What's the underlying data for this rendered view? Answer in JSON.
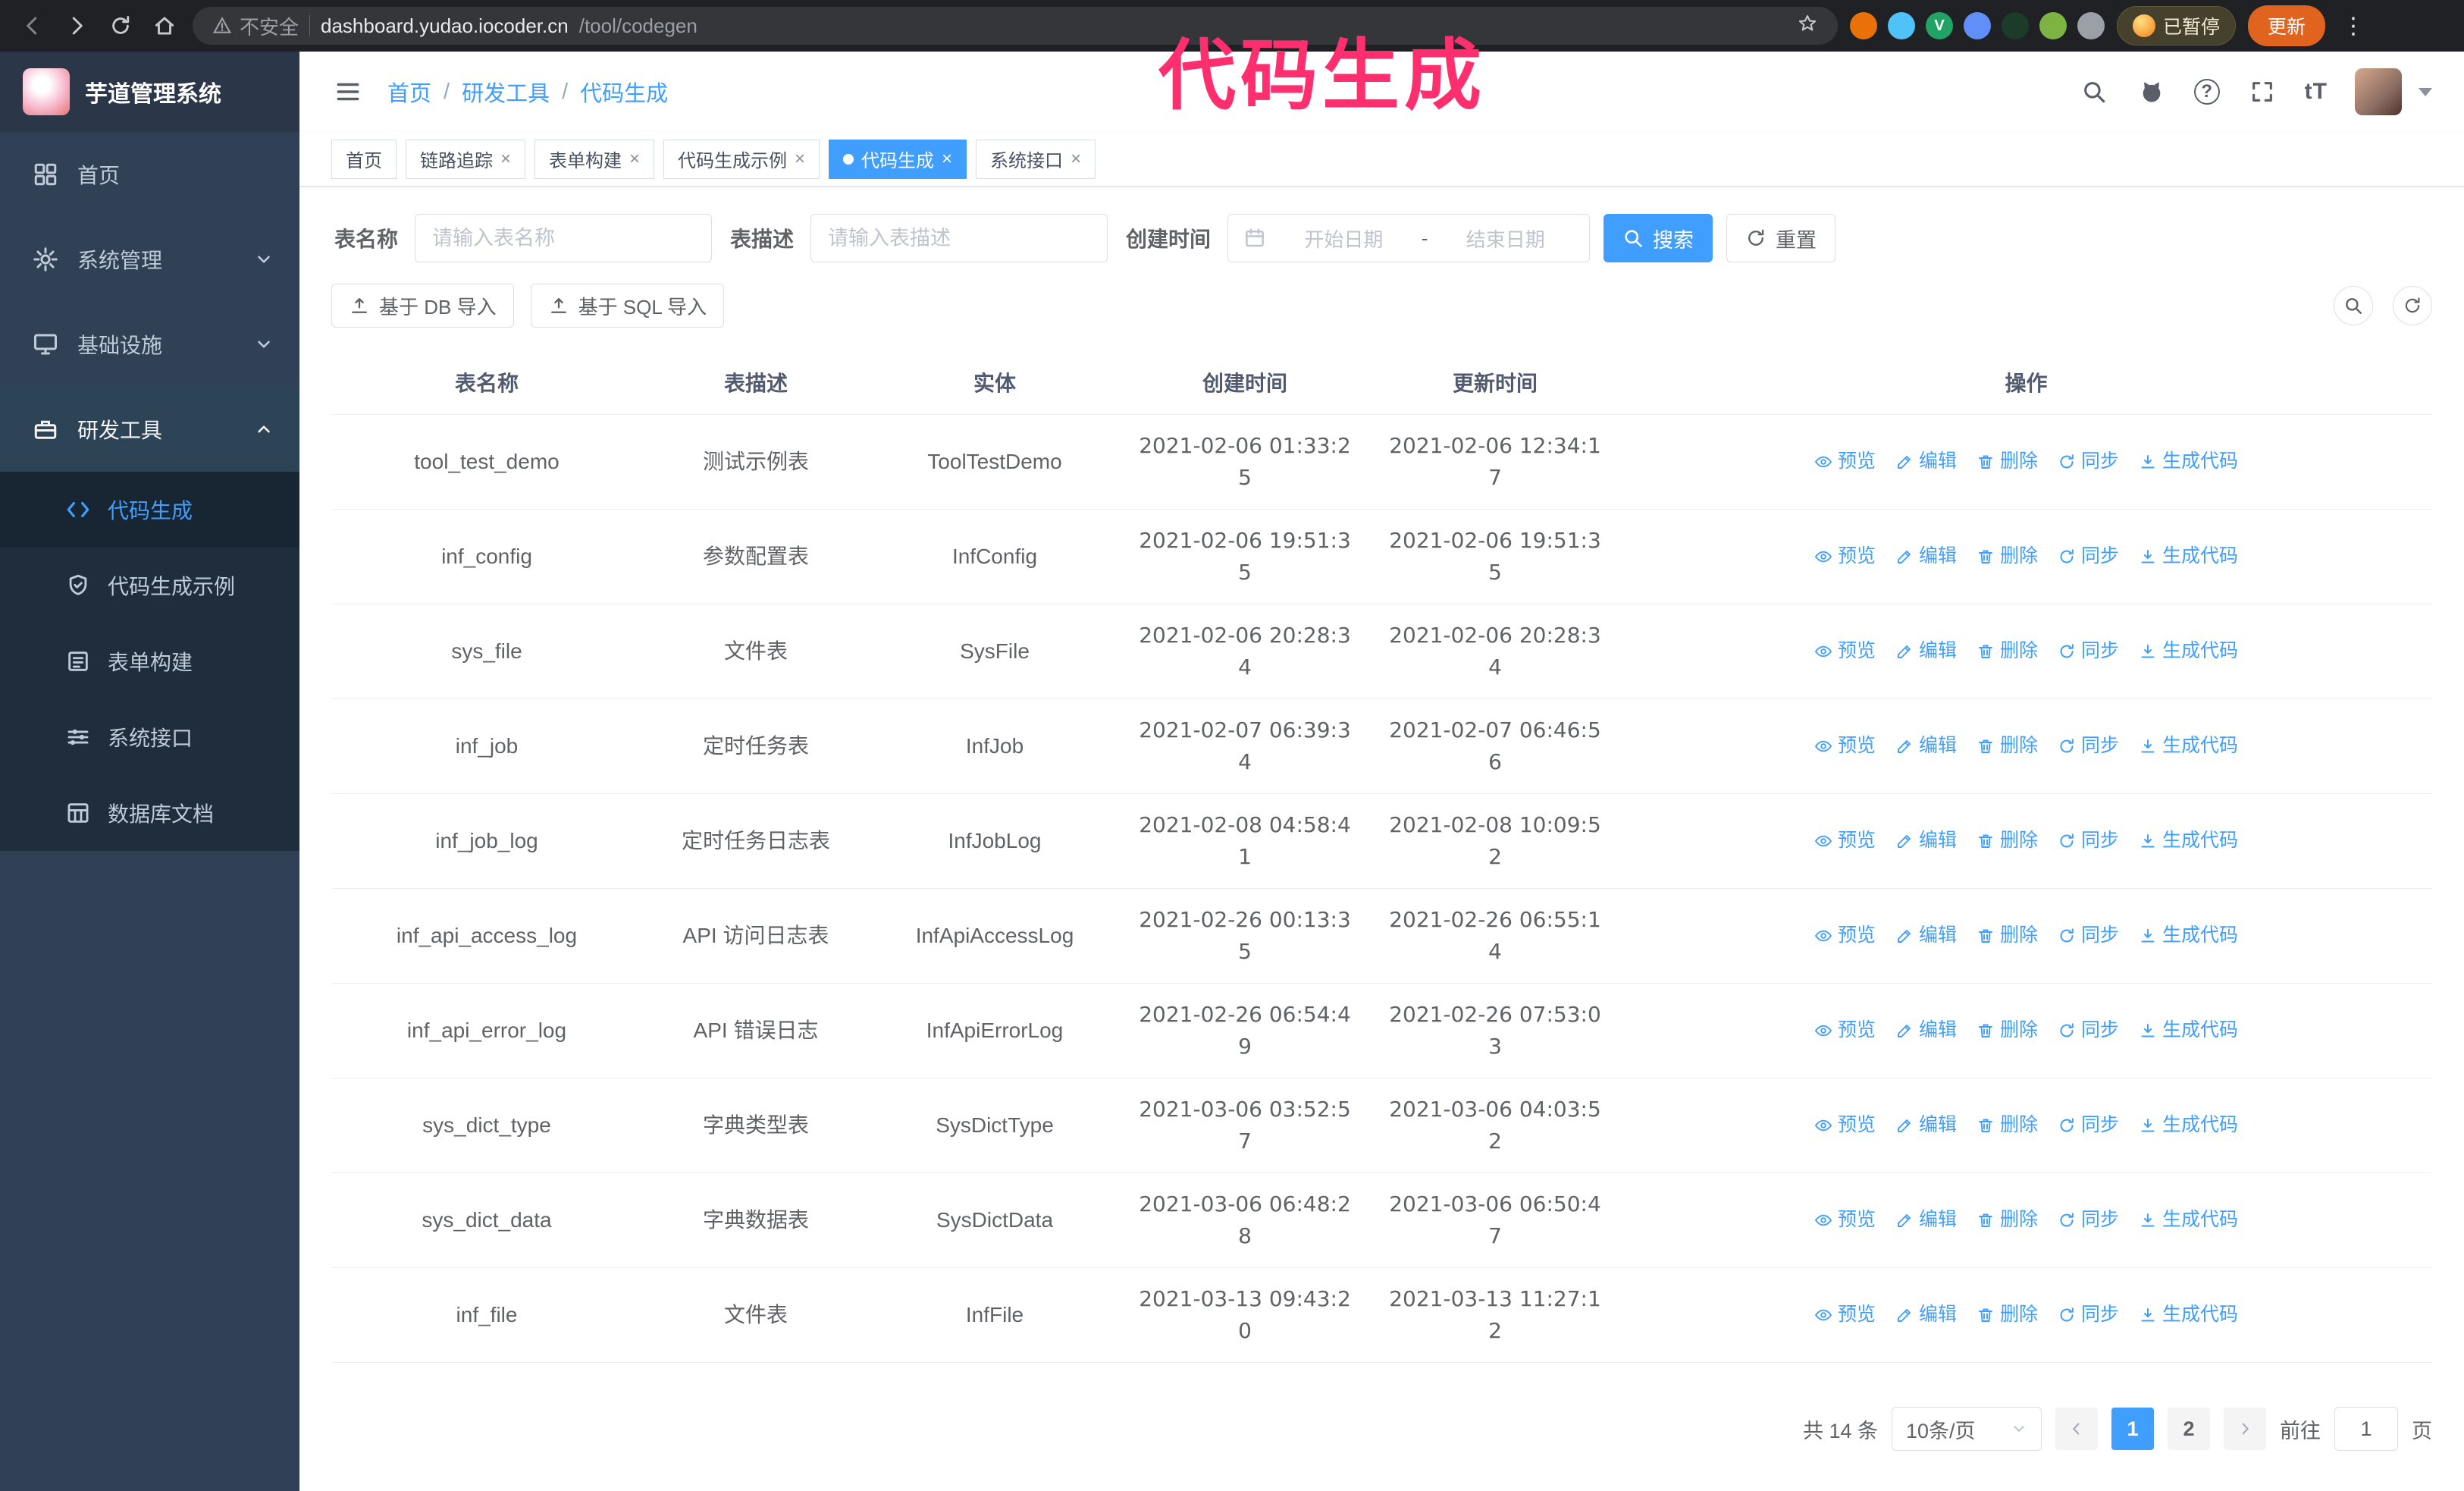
{
  "annotation": {
    "text": "代码生成"
  },
  "colors": {
    "accent": "#409eff",
    "sidebar_bg": "#304156",
    "submenu_bg": "#1f2d3d",
    "annotation_pink": "#ff2f6f",
    "update_orange": "#e0641e"
  },
  "browser": {
    "security_label": "不安全",
    "url_host": "dashboard.yudao.iocoder.cn",
    "url_path": "/tool/codegen",
    "extension_v_label": "V",
    "paused_badge": "已暂停",
    "update_button": "更新"
  },
  "sidebar": {
    "logo_title": "芋道管理系统",
    "items": [
      {
        "label": "首页"
      },
      {
        "label": "系统管理"
      },
      {
        "label": "基础设施"
      },
      {
        "label": "研发工具"
      }
    ],
    "subitems": [
      {
        "label": "代码生成"
      },
      {
        "label": "代码生成示例"
      },
      {
        "label": "表单构建"
      },
      {
        "label": "系统接口"
      },
      {
        "label": "数据库文档"
      }
    ]
  },
  "header": {
    "breadcrumb": [
      "首页",
      "研发工具",
      "代码生成"
    ],
    "separator": "/"
  },
  "tabs": [
    {
      "label": "首页"
    },
    {
      "label": "链路追踪"
    },
    {
      "label": "表单构建"
    },
    {
      "label": "代码生成示例"
    },
    {
      "label": "代码生成"
    },
    {
      "label": "系统接口"
    }
  ],
  "filters": {
    "table_name_label": "表名称",
    "table_name_placeholder": "请输入表名称",
    "table_desc_label": "表描述",
    "table_desc_placeholder": "请输入表描述",
    "create_time_label": "创建时间",
    "date_start_placeholder": "开始日期",
    "date_separator": "-",
    "date_end_placeholder": "结束日期",
    "search_button": "搜索",
    "reset_button": "重置"
  },
  "toolbar": {
    "import_db": "基于 DB 导入",
    "import_sql": "基于 SQL 导入"
  },
  "icons": {
    "search": "magnifier",
    "github": "github-cat",
    "help": "question-circle",
    "fullscreen": "expand-corners",
    "font_size": "tT",
    "refresh": "circular-arrows",
    "upload": "upload-tray",
    "calendar": "calendar",
    "preview": "eye",
    "edit": "pencil",
    "delete": "trash",
    "sync": "circular-arrows",
    "generate": "download-tray"
  },
  "table": {
    "columns": [
      "表名称",
      "表描述",
      "实体",
      "创建时间",
      "更新时间",
      "操作"
    ],
    "actions": [
      "预览",
      "编辑",
      "删除",
      "同步",
      "生成代码"
    ],
    "rows": [
      {
        "name": "tool_test_demo",
        "desc": "测试示例表",
        "entity": "ToolTestDemo",
        "created": "2021-02-06 01:33:25",
        "updated": "2021-02-06 12:34:17"
      },
      {
        "name": "inf_config",
        "desc": "参数配置表",
        "entity": "InfConfig",
        "created": "2021-02-06 19:51:35",
        "updated": "2021-02-06 19:51:35"
      },
      {
        "name": "sys_file",
        "desc": "文件表",
        "entity": "SysFile",
        "created": "2021-02-06 20:28:34",
        "updated": "2021-02-06 20:28:34"
      },
      {
        "name": "inf_job",
        "desc": "定时任务表",
        "entity": "InfJob",
        "created": "2021-02-07 06:39:34",
        "updated": "2021-02-07 06:46:56"
      },
      {
        "name": "inf_job_log",
        "desc": "定时任务日志表",
        "entity": "InfJobLog",
        "created": "2021-02-08 04:58:41",
        "updated": "2021-02-08 10:09:52"
      },
      {
        "name": "inf_api_access_log",
        "desc": "API 访问日志表",
        "entity": "InfApiAccessLog",
        "created": "2021-02-26 00:13:35",
        "updated": "2021-02-26 06:55:14"
      },
      {
        "name": "inf_api_error_log",
        "desc": "API 错误日志",
        "entity": "InfApiErrorLog",
        "created": "2021-02-26 06:54:49",
        "updated": "2021-02-26 07:53:03"
      },
      {
        "name": "sys_dict_type",
        "desc": "字典类型表",
        "entity": "SysDictType",
        "created": "2021-03-06 03:52:57",
        "updated": "2021-03-06 04:03:52"
      },
      {
        "name": "sys_dict_data",
        "desc": "字典数据表",
        "entity": "SysDictData",
        "created": "2021-03-06 06:48:28",
        "updated": "2021-03-06 06:50:47"
      },
      {
        "name": "inf_file",
        "desc": "文件表",
        "entity": "InfFile",
        "created": "2021-03-13 09:43:20",
        "updated": "2021-03-13 11:27:12"
      }
    ]
  },
  "pagination": {
    "total": "共 14 条",
    "page_size": "10条/页",
    "pages": [
      "1",
      "2"
    ],
    "goto_label": "前往",
    "goto_value": "1",
    "goto_suffix": "页"
  }
}
